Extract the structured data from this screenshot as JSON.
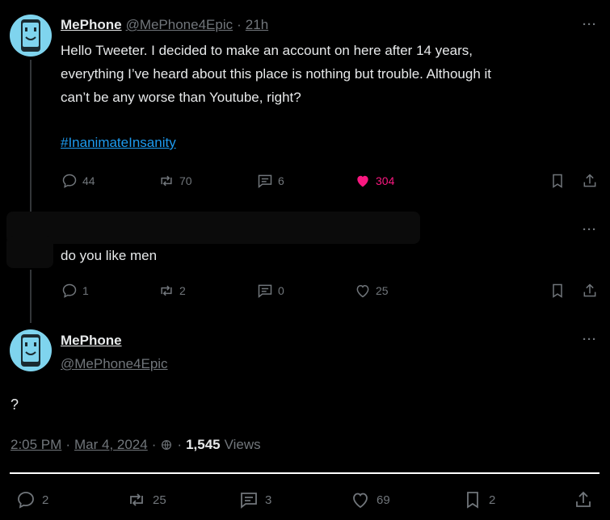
{
  "tweet1": {
    "name": "MePhone",
    "handle": "@MePhone4Epic",
    "time": "21h",
    "text_lines": [
      "Hello Tweeter. I decided to make an account on here after 14 years,",
      "everything I’ve heard about this place is nothing but trouble. Although it",
      "can’t be any worse than Youtube, right?"
    ],
    "hashtag": "#InanimateInsanity",
    "actions": {
      "replies": "44",
      "reposts": "70",
      "quotes": "6",
      "likes": "304"
    }
  },
  "tweet2": {
    "text": "do you like men",
    "actions": {
      "replies": "1",
      "reposts": "2",
      "quotes": "0",
      "likes": "25"
    }
  },
  "tweet3": {
    "name": "MePhone",
    "handle": "@MePhone4Epic",
    "text": "?",
    "time": "2:05 PM",
    "date": "Mar 4, 2024",
    "views_count": "1,545",
    "views_label": "Views",
    "actions": {
      "replies": "2",
      "reposts": "25",
      "quotes": "3",
      "likes": "69",
      "bookmarks": "2"
    }
  },
  "more_label": "···",
  "colors": {
    "accent": "#1d9bf0",
    "like": "#f91880",
    "muted": "#71767b",
    "avatar": "#7fd4ee"
  }
}
